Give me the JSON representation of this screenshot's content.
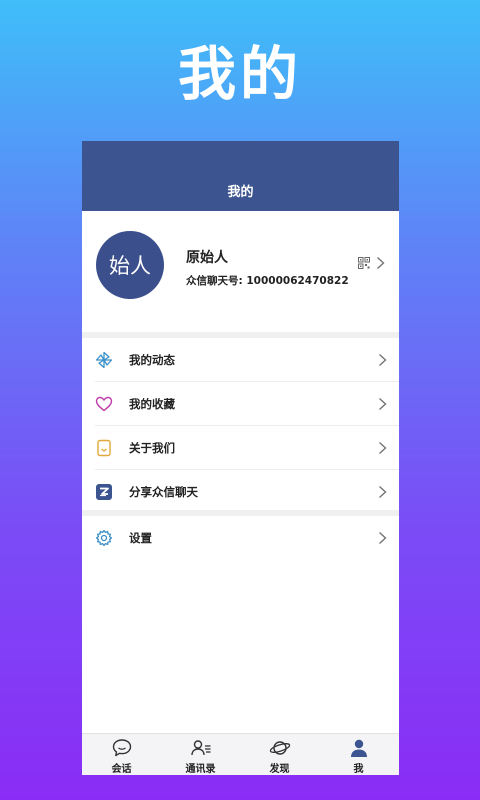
{
  "promo": {
    "title": "我的"
  },
  "header": {
    "title": "我的"
  },
  "profile": {
    "avatar_text": "始人",
    "name": "原始人",
    "id_text": "众信聊天号: 10000062470822"
  },
  "menu": [
    {
      "label": "我的动态",
      "icon": "pinwheel-icon",
      "color": "#3a8fc8"
    },
    {
      "label": "我的收藏",
      "icon": "heart-icon",
      "color": "#c03aa8"
    },
    {
      "label": "关于我们",
      "icon": "bookmark-icon",
      "color": "#e0a83a"
    },
    {
      "label": "分享众信聊天",
      "icon": "share-logo-icon",
      "color": "#3c5590"
    }
  ],
  "settings": {
    "label": "设置",
    "icon": "gear-icon"
  },
  "tabs": [
    {
      "label": "会话",
      "icon": "chat-bubble-icon"
    },
    {
      "label": "通讯录",
      "icon": "contacts-icon"
    },
    {
      "label": "发现",
      "icon": "planet-icon"
    },
    {
      "label": "我",
      "icon": "person-icon",
      "active": true
    }
  ],
  "colors": {
    "header": "#3c5590",
    "avatar": "#3b4f8c",
    "active_tab": "#3c5590"
  }
}
